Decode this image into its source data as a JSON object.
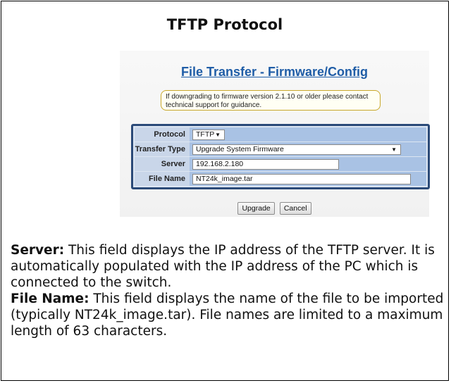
{
  "card": {
    "title": "TFTP Protocol"
  },
  "form": {
    "title": "File Transfer - Firmware/Config",
    "notice": "If downgrading to firmware version 2.1.10 or older please contact technical support for guidance.",
    "fields": [
      {
        "label": "Protocol",
        "value": "TFTP",
        "type": "select",
        "arrow": "▼"
      },
      {
        "label": "Transfer Type",
        "value": "Upgrade System Firmware",
        "type": "select",
        "arrow": "▼"
      },
      {
        "label": "Server",
        "value": "192.168.2.180",
        "type": "input"
      },
      {
        "label": "File Name",
        "value": "NT24k_image.tar",
        "type": "input"
      }
    ],
    "buttons": {
      "upgrade": "Upgrade",
      "cancel": "Cancel"
    }
  },
  "description": {
    "server": {
      "term": "Server:",
      "text": " This field displays the IP address of the TFTP server. It is automatically populated with the IP address of the PC which is connected to the switch."
    },
    "filename": {
      "term": "File Name:",
      "text": " This field displays the name of the file to be imported (typically NT24k_image.tar). File names are limited to a maximum length of 63 characters."
    }
  },
  "colors": {
    "title_link": "#1f5da7",
    "table_border": "#2b4a78",
    "table_cell": "#a9c2e4",
    "notice_border": "#c9a82a"
  }
}
